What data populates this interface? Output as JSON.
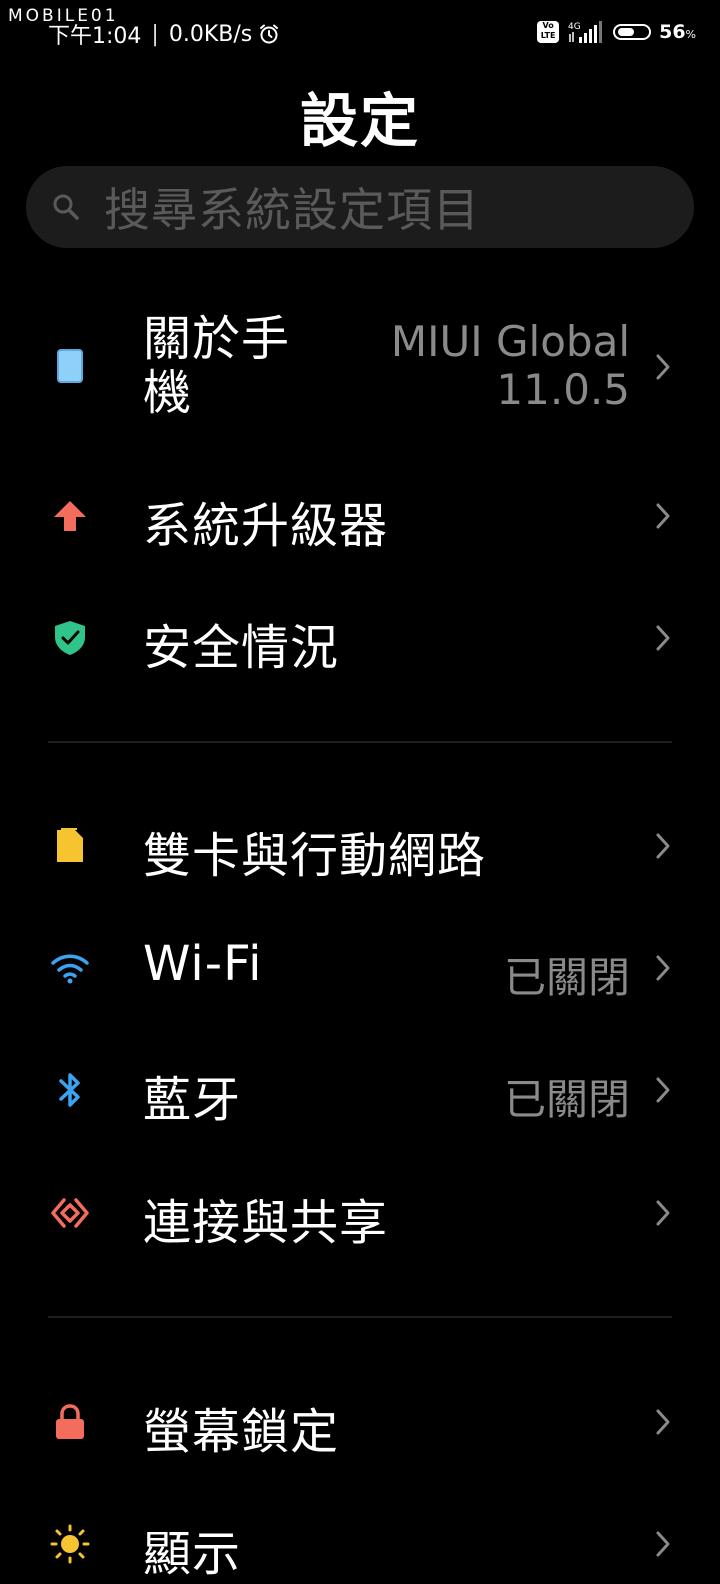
{
  "watermark": "MOBILE01",
  "status_bar": {
    "time": "下午1:04",
    "speed": "0.0KB/s",
    "network": "4G",
    "volte": "Vo LTE",
    "battery_level": 56,
    "battery_text": "56",
    "battery_unit": "%"
  },
  "title": "設定",
  "search": {
    "placeholder": "搜尋系統設定項目"
  },
  "items": [
    {
      "label": "關於手機",
      "value": "MIUI Global 11.0.5",
      "icon": "phone-icon",
      "color": "#8fd0f8"
    },
    {
      "label": "系統升級器",
      "value": "",
      "icon": "upgrade-arrow-icon",
      "color": "#f36d5d"
    },
    {
      "label": "安全情況",
      "value": "",
      "icon": "shield-check-icon",
      "color": "#2fc58a"
    },
    {
      "label": "雙卡與行動網路",
      "value": "",
      "icon": "sim-card-icon",
      "color": "#f6c431"
    },
    {
      "label": "Wi-Fi",
      "value": "已關閉",
      "icon": "wifi-icon",
      "color": "#3ba3f0"
    },
    {
      "label": "藍牙",
      "value": "已關閉",
      "icon": "bluetooth-icon",
      "color": "#3ba3f0"
    },
    {
      "label": "連接與共享",
      "value": "",
      "icon": "connection-sharing-icon",
      "color": "#f36d5d"
    },
    {
      "label": "螢幕鎖定",
      "value": "",
      "icon": "lock-icon",
      "color": "#f36d5d"
    },
    {
      "label": "顯示",
      "value": "",
      "icon": "sun-icon",
      "color": "#f6c431"
    }
  ]
}
